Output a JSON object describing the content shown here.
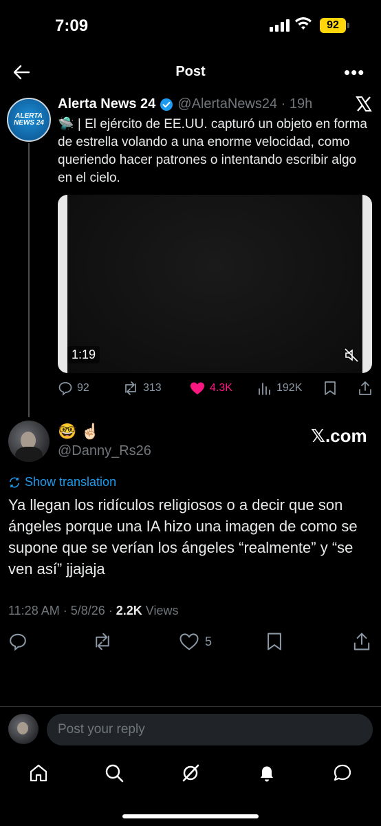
{
  "status": {
    "time": "7:09",
    "battery": "92"
  },
  "header": {
    "title": "Post"
  },
  "quoted": {
    "avatar_text_1": "ALERTA",
    "avatar_text_2": "NEWS 24",
    "name": "Alerta News 24",
    "handle_time": "@AlertaNews24 · 19h",
    "text": "🛸 | El ejército de EE.UU. capturó un objeto en forma de estrella volando a una enorme velocidad, como queriendo hacer patrones o intentando escribir algo en el cielo.",
    "video_duration": "1:19",
    "replies": "92",
    "reposts": "313",
    "likes": "4.3K",
    "views": "192K"
  },
  "reply": {
    "emojis": "🤓 ☝🏻",
    "handle": "@Danny_Rs26",
    "source": "𝕏.com",
    "show_translation": "Show translation",
    "text": "Ya llegan los ridículos religiosos o a decir que son ángeles porque una IA hizo una imagen de como se supone que se verían los ángeles “realmente” y “se ven así” jjajaja",
    "meta_time": "11:28 AM · 5/8/26 · ",
    "meta_views_count": "2.2K",
    "meta_views_label": " Views",
    "likes": "5"
  },
  "composer": {
    "placeholder": "Post your reply"
  },
  "colors": {
    "like": "#f91880",
    "link": "#1d9bf0",
    "muted": "#71767b",
    "battery": "#ffd60a"
  },
  "icons": [
    "back-arrow-icon",
    "more-icon",
    "verified-icon",
    "x-logo-icon",
    "mute-icon",
    "reply-icon",
    "repost-icon",
    "like-icon",
    "views-icon",
    "bookmark-icon",
    "share-icon",
    "translate-icon",
    "home-icon",
    "search-icon",
    "grok-icon",
    "bell-icon",
    "messages-icon"
  ]
}
